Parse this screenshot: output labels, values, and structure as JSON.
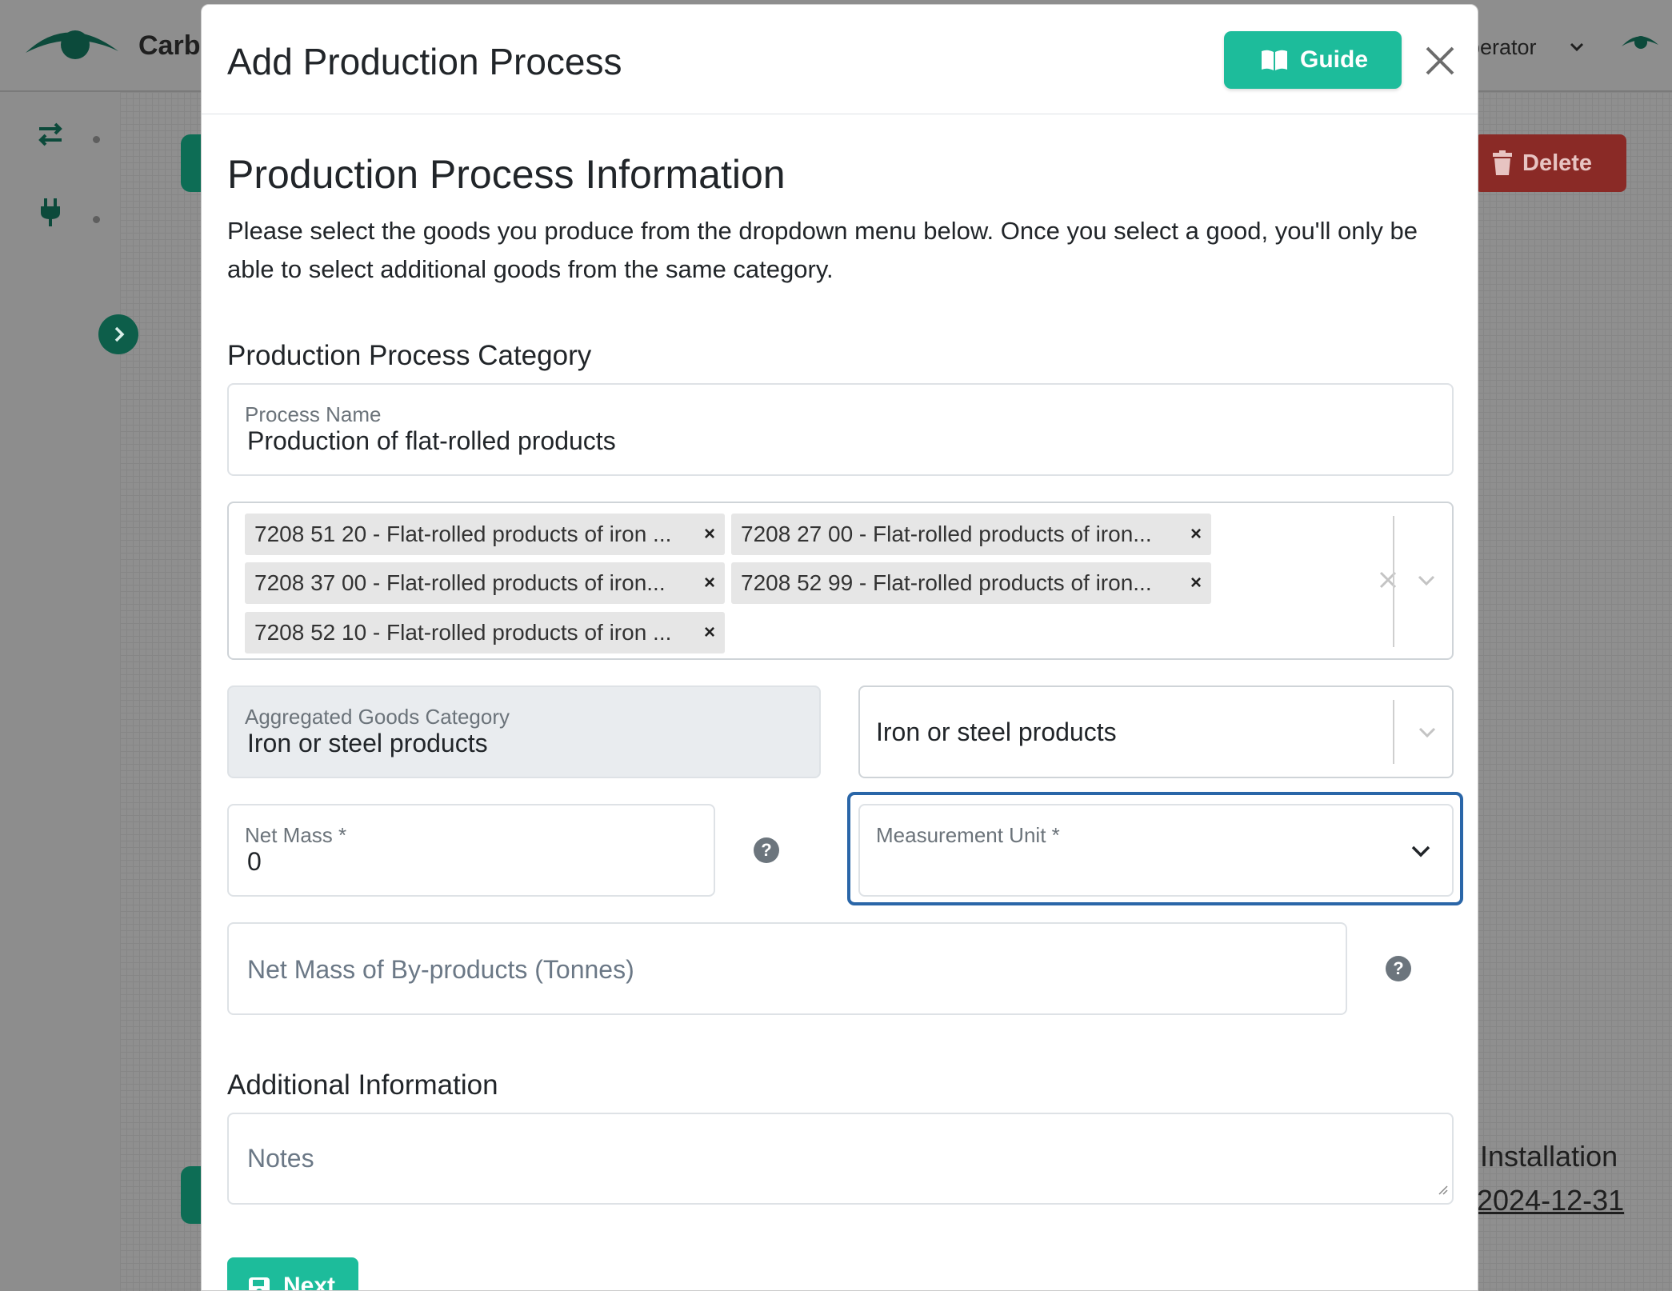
{
  "app": {
    "name": "Carb",
    "user_menu_label": "perator",
    "delete_label": "Delete",
    "installation_label": "Installation",
    "installation_date": "2024-12-31"
  },
  "modal": {
    "title": "Add Production Process",
    "guide_label": "Guide",
    "section_title": "Production Process Information",
    "intro": "Please select the goods you produce from the dropdown menu below. Once you select a good, you'll only be able to select additional goods from the same category.",
    "category_title": "Production Process Category",
    "process_name": {
      "label": "Process Name",
      "value": "Production of flat-rolled products"
    },
    "goods_tags": [
      "7208 51 20 - Flat-rolled products of iron ...",
      "7208 27 00 - Flat-rolled products of iron...",
      "7208 37 00 - Flat-rolled products of iron...",
      "7208 52 99 - Flat-rolled products of iron...",
      "7208 52 10 - Flat-rolled products of iron ..."
    ],
    "aggregated_category": {
      "label": "Aggregated Goods Category",
      "value": "Iron or steel products"
    },
    "category_select_value": "Iron or steel products",
    "net_mass": {
      "label": "Net Mass *",
      "value": "0"
    },
    "measurement_unit": {
      "label": "Measurement Unit *"
    },
    "byproducts_placeholder": "Net Mass of By-products (Tonnes)",
    "additional_title": "Additional Information",
    "notes_placeholder": "Notes",
    "next_label": "Next",
    "help_glyph": "?",
    "tag_remove_glyph": "×"
  },
  "colors": {
    "accent": "#1dbc9b",
    "focus": "#2a66a8",
    "danger": "#c0392b"
  }
}
